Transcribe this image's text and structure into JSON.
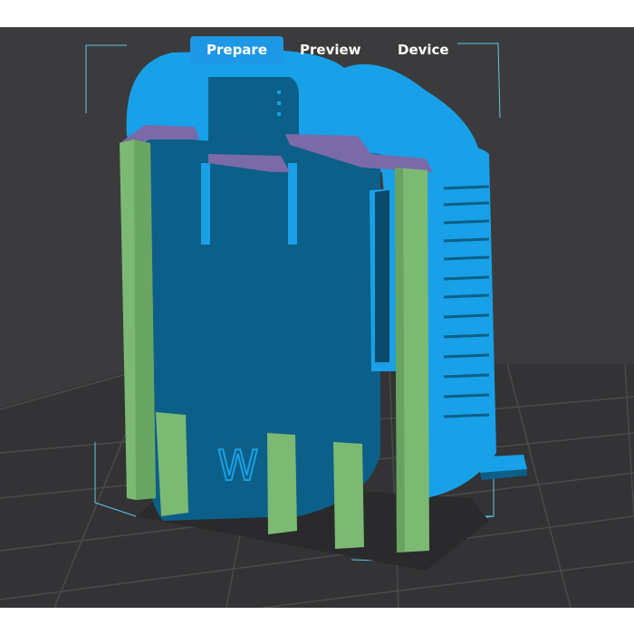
{
  "toolbar": {
    "tabs": [
      {
        "label": "Prepare",
        "active": true
      },
      {
        "label": "Preview",
        "active": false
      },
      {
        "label": "Device",
        "active": false
      }
    ],
    "accent_color": "#1e97e6"
  },
  "viewport": {
    "background_color": "#3b3b3d",
    "grid_color": "#4c4c4e",
    "model_colors": {
      "body": "#1aa0e6",
      "body_dark": "#0c5f88",
      "supports": "#7cba74",
      "interface": "#7a6aa8",
      "bounding_box": "#5fc4e8"
    },
    "model_text": "W"
  }
}
